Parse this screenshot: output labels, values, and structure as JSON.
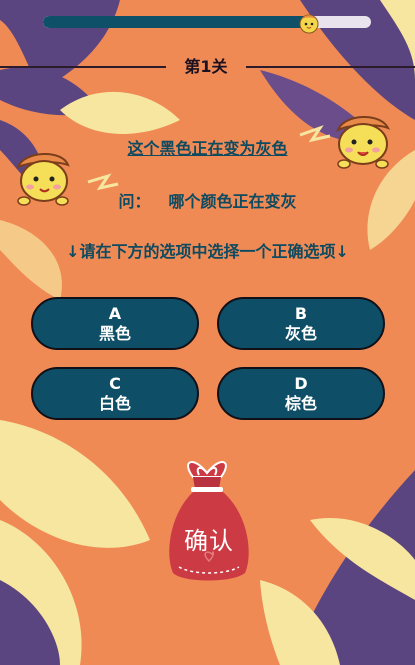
{
  "progress": {
    "fraction": 0.81
  },
  "level": {
    "title": "第1关"
  },
  "question": {
    "statement": "这个黑色正在变为灰色",
    "prompt_label": "问：",
    "prompt_text": "哪个颜色正在变灰",
    "instruction": "↓请在下方的选项中选择一个正确选项↓"
  },
  "options": [
    {
      "letter": "A",
      "text": "黑色"
    },
    {
      "letter": "B",
      "text": "灰色"
    },
    {
      "letter": "C",
      "text": "白色"
    },
    {
      "letter": "D",
      "text": "棕色"
    }
  ],
  "confirm": {
    "label": "确认"
  },
  "colors": {
    "background": "#f08a55",
    "leaf_dark": "#5b4580",
    "leaf_light": "#f7e6a0",
    "accent": "#0e4e66",
    "bag": "#cc3a44"
  }
}
